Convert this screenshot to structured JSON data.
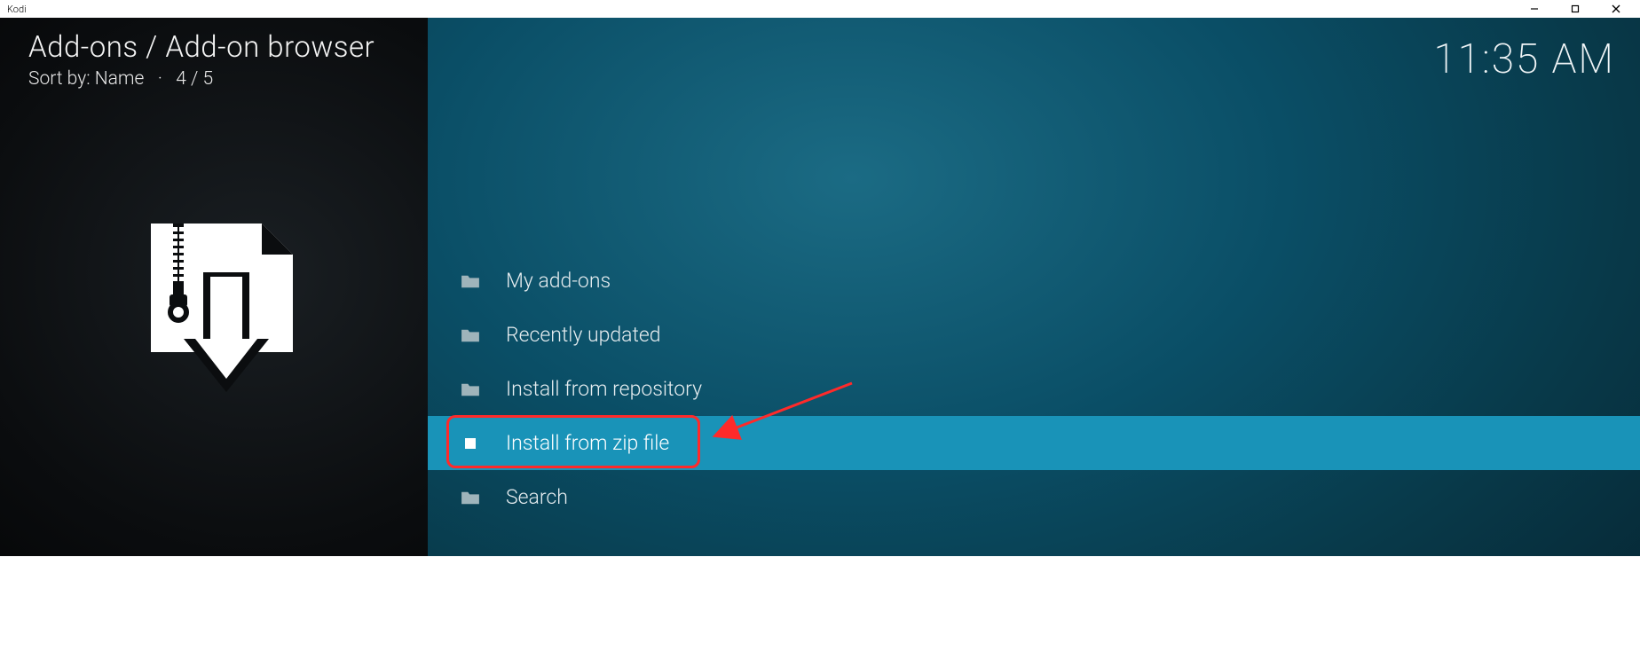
{
  "window": {
    "title": "Kodi"
  },
  "header": {
    "breadcrumb": "Add-ons / Add-on browser",
    "sort_label": "Sort by: Name",
    "position": "4 / 5"
  },
  "clock": "11:35 AM",
  "menu": {
    "items": [
      {
        "label": "My add-ons",
        "icon": "folder",
        "selected": false
      },
      {
        "label": "Recently updated",
        "icon": "folder",
        "selected": false
      },
      {
        "label": "Install from repository",
        "icon": "folder",
        "selected": false
      },
      {
        "label": "Install from zip file",
        "icon": "file",
        "selected": true
      },
      {
        "label": "Search",
        "icon": "folder",
        "selected": false
      }
    ]
  },
  "annotation": {
    "highlight_index": 3,
    "color": "#ff2a2a"
  }
}
